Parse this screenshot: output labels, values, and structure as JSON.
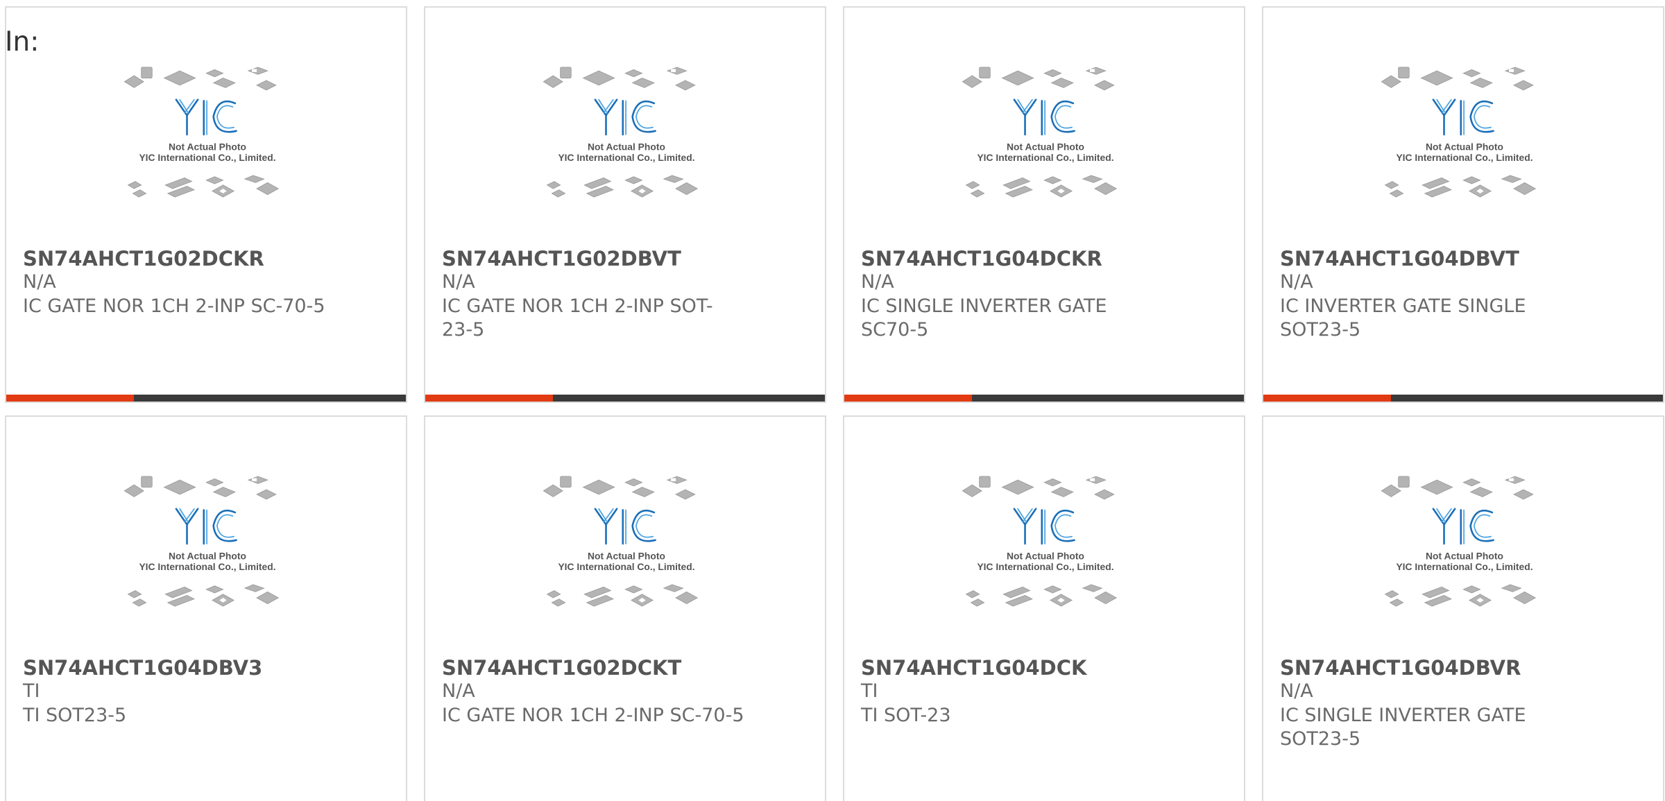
{
  "header": {
    "label": "In:"
  },
  "image_caption": {
    "line1": "Not Actual Photo",
    "line2": "YIC International Co., Limited.",
    "logo_text": "YIC"
  },
  "products": [
    {
      "part": "SN74AHCT1G02DCKR",
      "mfr": "N/A",
      "desc": "IC GATE NOR 1CH 2-INP SC-70-5"
    },
    {
      "part": "SN74AHCT1G02DBVT",
      "mfr": "N/A",
      "desc": "IC GATE NOR 1CH 2-INP SOT-23-5"
    },
    {
      "part": "SN74AHCT1G04DCKR",
      "mfr": "N/A",
      "desc": "IC SINGLE INVERTER GATE SC70-5"
    },
    {
      "part": "SN74AHCT1G04DBVT",
      "mfr": "N/A",
      "desc": "IC INVERTER GATE SINGLE SOT23-5"
    },
    {
      "part": "SN74AHCT1G04DBV3",
      "mfr": "TI",
      "desc": "TI SOT23-5"
    },
    {
      "part": "SN74AHCT1G02DCKT",
      "mfr": "N/A",
      "desc": "IC GATE NOR 1CH 2-INP SC-70-5"
    },
    {
      "part": "SN74AHCT1G04DCK",
      "mfr": "TI",
      "desc": "TI SOT-23"
    },
    {
      "part": "SN74AHCT1G04DBVR",
      "mfr": "N/A",
      "desc": "IC SINGLE INVERTER GATE SOT23-5"
    }
  ],
  "colors": {
    "accent": "#e23a12",
    "bar": "#3a3a3a",
    "logo": "#1b6fb8"
  }
}
